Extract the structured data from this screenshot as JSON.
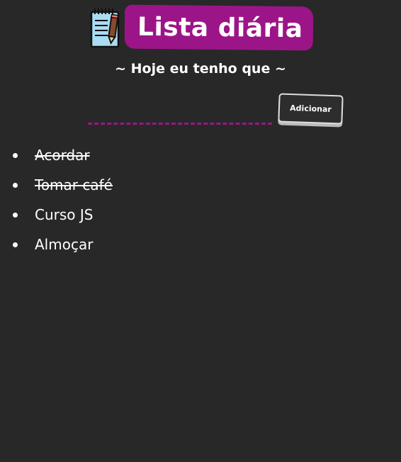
{
  "header": {
    "title": "Lista diária",
    "icon": "notepad-pencil-icon",
    "accent_color": "#9c1588"
  },
  "subtitle": "~ Hoje eu tenho que ~",
  "task_input": {
    "value": "",
    "placeholder": ""
  },
  "add_button": {
    "label": "Adicionar"
  },
  "tasks": [
    {
      "text": "Acordar",
      "done": true
    },
    {
      "text": "Tomar café",
      "done": true
    },
    {
      "text": "Curso JS",
      "done": false
    },
    {
      "text": "Almoçar",
      "done": false
    }
  ],
  "colors": {
    "background": "#282828",
    "text": "#ffffff",
    "accent": "#9c1588"
  }
}
